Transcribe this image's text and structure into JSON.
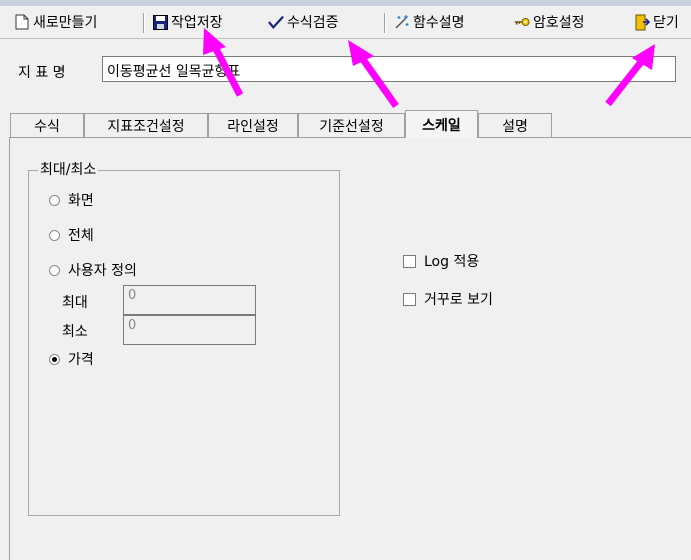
{
  "toolbar": {
    "new_label": "새로만들기",
    "save_label": "작업저장",
    "verify_label": "수식검증",
    "help_label": "함수설명",
    "password_label": "암호설정",
    "close_label": "닫기"
  },
  "indicator": {
    "name_label": "지 표 명",
    "name_value": "이동평균선 일목균형표"
  },
  "tabs": [
    {
      "label": "수식"
    },
    {
      "label": "지표조건설정"
    },
    {
      "label": "라인설정"
    },
    {
      "label": "기준선설정"
    },
    {
      "label": "스케일"
    },
    {
      "label": "설명"
    }
  ],
  "active_tab": "스케일",
  "scale": {
    "group_title": "최대/최소",
    "options": [
      {
        "label": "화면",
        "selected": false
      },
      {
        "label": "전체",
        "selected": false
      },
      {
        "label": "사용자 정의",
        "selected": false
      },
      {
        "label": "가격",
        "selected": true
      }
    ],
    "max_label": "최대",
    "max_value": "0",
    "min_label": "최소",
    "min_value": "0"
  },
  "checks": [
    {
      "label": "Log 적용",
      "checked": false
    },
    {
      "label": "거꾸로 보기",
      "checked": false
    }
  ],
  "colors": {
    "annotation_arrow": "#ff00ff",
    "background": "#f0f0f0"
  }
}
